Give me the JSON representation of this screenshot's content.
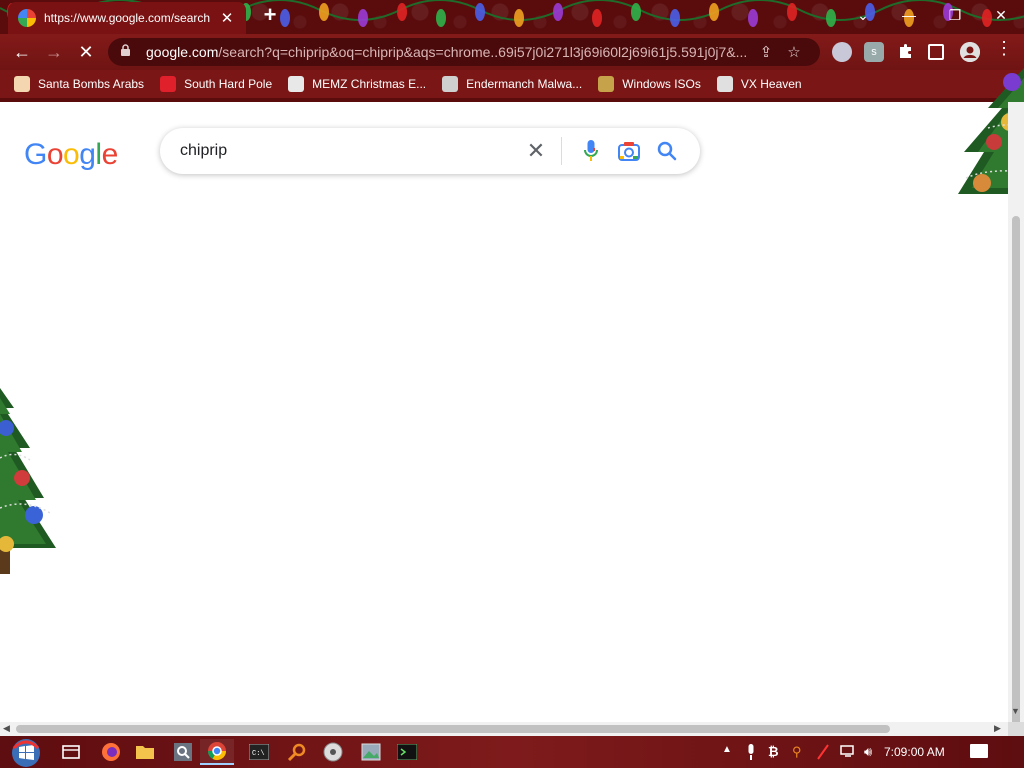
{
  "browser": {
    "tab": {
      "title": "https://www.google.com/search",
      "close_glyph": "✕"
    },
    "new_tab_glyph": "+",
    "window_controls": {
      "tab_list": "⌄",
      "minimize": "—",
      "restore": "❐",
      "close": "✕"
    },
    "nav": {
      "back": "←",
      "forward": "→",
      "reload": "✕"
    },
    "url": {
      "host": "google.com",
      "rest": "/search?q=chiprip&oq=chiprip&aqs=chrome..69i57j0i271l3j69i60l2j69i61j5.591j0j7&..."
    },
    "extension_badge": "s",
    "menu_glyph": "⋮"
  },
  "bookmarks": [
    {
      "label": "Santa Bombs Arabs",
      "icon": "santa-icon",
      "color": "#f4d7b0"
    },
    {
      "label": "South Hard Pole",
      "icon": "snowflake-icon",
      "color": "#e0202b"
    },
    {
      "label": "MEMZ Christmas E...",
      "icon": "image-icon",
      "color": "#e8e8e8"
    },
    {
      "label": "Endermanch Malwa...",
      "icon": "raccoon-icon",
      "color": "#cfcfcf"
    },
    {
      "label": "Windows ISOs",
      "icon": "tree-icon",
      "color": "#c6a34b"
    },
    {
      "label": "VX Heaven",
      "icon": "skull-icon",
      "color": "#e0e0e0"
    }
  ],
  "page": {
    "logo_letters": [
      {
        "ch": "G",
        "color": "#4285f4"
      },
      {
        "ch": "o",
        "color": "#ea4335"
      },
      {
        "ch": "o",
        "color": "#fbbc05"
      },
      {
        "ch": "g",
        "color": "#4285f4"
      },
      {
        "ch": "l",
        "color": "#34a853"
      },
      {
        "ch": "e",
        "color": "#ea4335"
      }
    ],
    "search": {
      "query": "chiprip",
      "clear_glyph": "✕"
    }
  },
  "taskbar": {
    "apps": [
      "task-view-icon",
      "firefox-icon",
      "file-explorer-icon",
      "search-app-icon",
      "chrome-icon",
      "cmd-icon",
      "magnifier-icon",
      "cd-icon",
      "photos-icon",
      "terminal-icon"
    ],
    "clock": "7:09:00 AM"
  },
  "colors": {
    "chrome_frame": "#7b1616",
    "tab_strip": "#5a0c0d",
    "google_blue": "#4285f4",
    "google_red": "#ea4335",
    "google_yellow": "#fbbc05",
    "google_green": "#34a853"
  }
}
